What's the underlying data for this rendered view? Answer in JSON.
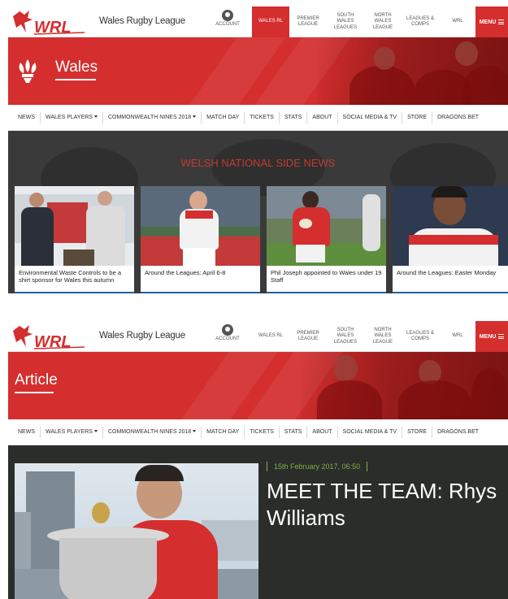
{
  "header": {
    "site_title": "Wales Rugby League",
    "logo_text": "WRL",
    "account_label": "Account",
    "nav": [
      {
        "label": "Wales RL"
      },
      {
        "label": "Premier League"
      },
      {
        "label": "South Wales Leagues"
      },
      {
        "label": "North Wales League"
      },
      {
        "label": "Leagues & Comps"
      },
      {
        "label": "WRL"
      }
    ],
    "menu_label": "MENU"
  },
  "page1": {
    "banner_title": "Wales",
    "subnav": [
      {
        "label": "News"
      },
      {
        "label": "Wales Players",
        "dropdown": true
      },
      {
        "label": "Commonwealth Nines 2018",
        "dropdown": true
      },
      {
        "label": "Match Day"
      },
      {
        "label": "Tickets"
      },
      {
        "label": "Stats"
      },
      {
        "label": "About"
      },
      {
        "label": "Social Media & TV"
      },
      {
        "label": "Store"
      },
      {
        "label": "Dragons.Bet"
      }
    ],
    "news_heading": "WELSH NATIONAL SIDE NEWS",
    "cards": [
      {
        "caption": "Environmental Waste Controls to be a shirt sponsor for Wales this autumn"
      },
      {
        "caption": "Around the Leagues: April 6-8"
      },
      {
        "caption": "Phil Joseph appointed to Wales under 19 Staff"
      },
      {
        "caption": "Around the Leagues: Easter Monday"
      }
    ]
  },
  "page2": {
    "banner_title": "Article",
    "subnav": [
      {
        "label": "News"
      },
      {
        "label": "Wales Players",
        "dropdown": true
      },
      {
        "label": "Commonwealth Nines 2018",
        "dropdown": true
      },
      {
        "label": "Match Day"
      },
      {
        "label": "Tickets"
      },
      {
        "label": "Stats"
      },
      {
        "label": "About"
      },
      {
        "label": "Social Media & TV"
      },
      {
        "label": "Store"
      },
      {
        "label": "Dragons.Bet"
      }
    ],
    "article_date": "15th February 2017, 06:50",
    "article_title": "MEET THE TEAM: Rhys Williams"
  },
  "colors": {
    "brand_red": "#d42e2e",
    "news_heading": "#c23b30",
    "date_green": "#7cb342",
    "article_bg": "#2b2d2b"
  },
  "icons": [
    "dragon-logo-icon",
    "account-icon",
    "menu-burger-icon",
    "prince-of-wales-feathers-icon",
    "dropdown-caret-icon"
  ]
}
